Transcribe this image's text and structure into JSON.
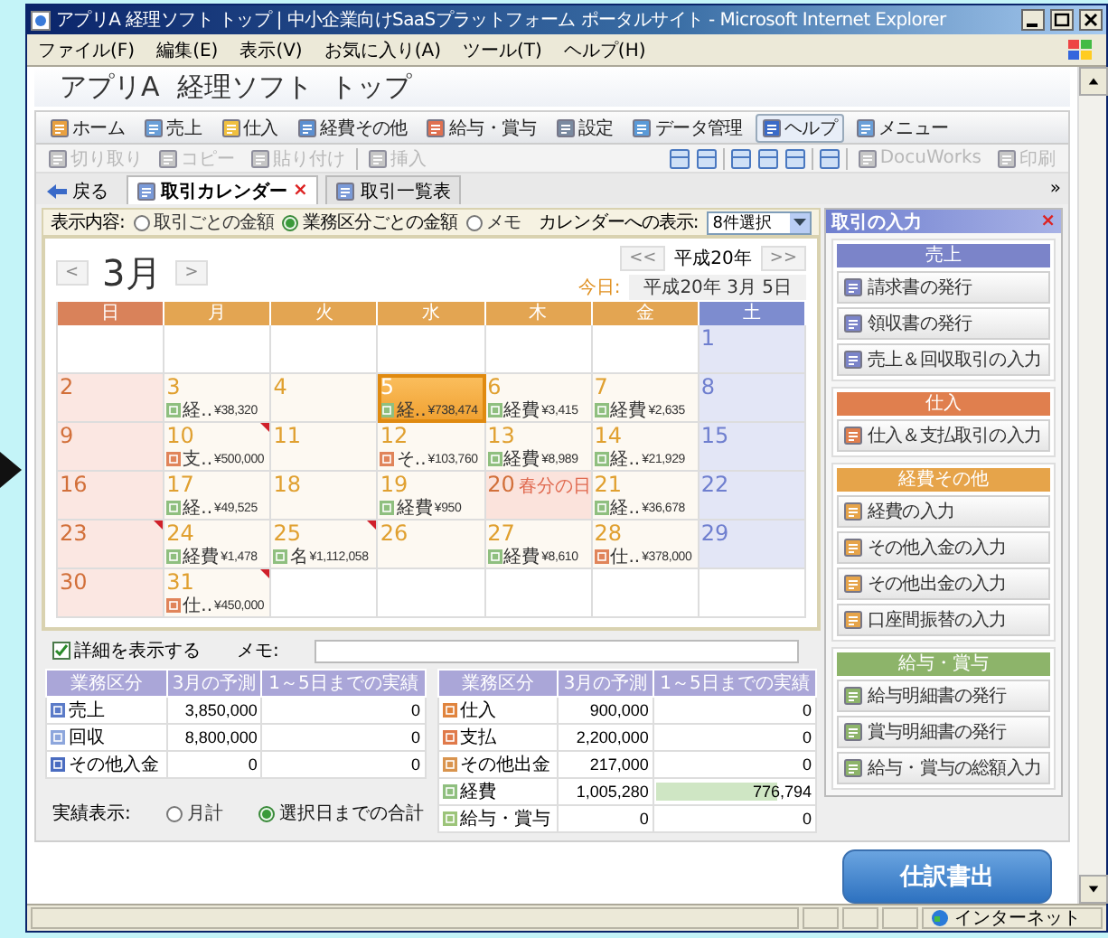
{
  "window": {
    "title": "アプリA  経理ソフト  トップ | 中小企業向けSaaSプラットフォーム ポータルサイト - Microsoft Internet Explorer"
  },
  "menu": [
    "ファイル(F)",
    "編集(E)",
    "表示(V)",
    "お気に入り(A)",
    "ツール(T)",
    "ヘルプ(H)"
  ],
  "page_title": "アプリA  経理ソフト  トップ",
  "main_toolbar": [
    {
      "label": "ホーム",
      "hovered": false
    },
    {
      "label": "売上",
      "hovered": false
    },
    {
      "label": "仕入",
      "hovered": false
    },
    {
      "label": "経費その他",
      "hovered": false
    },
    {
      "label": "給与・賞与",
      "hovered": false
    },
    {
      "label": "設定",
      "hovered": false
    },
    {
      "label": "データ管理",
      "hovered": false
    },
    {
      "label": "ヘルプ",
      "hovered": true
    },
    {
      "label": "メニュー",
      "hovered": false
    }
  ],
  "edit_toolbar": [
    {
      "kind": "button",
      "label": "切り取り",
      "disabled": true
    },
    {
      "kind": "button",
      "label": "コピー",
      "disabled": true
    },
    {
      "kind": "button",
      "label": "貼り付け",
      "disabled": true
    },
    {
      "kind": "separator"
    },
    {
      "kind": "button",
      "label": "挿入",
      "disabled": true
    },
    {
      "kind": "spacer"
    },
    {
      "kind": "icon",
      "disabled": false
    },
    {
      "kind": "icon",
      "disabled": false
    },
    {
      "kind": "separator"
    },
    {
      "kind": "icon",
      "disabled": false
    },
    {
      "kind": "icon",
      "disabled": false
    },
    {
      "kind": "icon",
      "disabled": false
    },
    {
      "kind": "separator"
    },
    {
      "kind": "icon",
      "disabled": false
    },
    {
      "kind": "separator"
    },
    {
      "kind": "button",
      "label": "DocuWorks",
      "disabled": true
    },
    {
      "kind": "button",
      "label": "印刷",
      "disabled": true
    }
  ],
  "nav": {
    "back": "戻る",
    "tabs": [
      {
        "label": "取引カレンダー",
        "selected": true,
        "close": "×"
      },
      {
        "label": "取引一覧表",
        "selected": false
      }
    ],
    "overflow": "»"
  },
  "display": {
    "label": "表示内容:",
    "options": [
      {
        "label": "取引ごとの金額",
        "selected": false
      },
      {
        "label": "業務区分ごとの金額",
        "selected": true
      },
      {
        "label": "メモ",
        "selected": false
      }
    ],
    "calendar_label": "カレンダーへの表示:",
    "calendar_select": "8件選択"
  },
  "calendar": {
    "month": "3月",
    "prev": "<",
    "next": ">",
    "year_prev": "<<",
    "year": "平成20年",
    "year_next": ">>",
    "today_label": "今日:",
    "today_value": "平成20年 3月 5日",
    "weekdays": [
      {
        "label": "日",
        "color": "#d9825a"
      },
      {
        "label": "月",
        "color": "#e3a552"
      },
      {
        "label": "火",
        "color": "#e3a552"
      },
      {
        "label": "水",
        "color": "#e3a552"
      },
      {
        "label": "木",
        "color": "#e3a552"
      },
      {
        "label": "金",
        "color": "#e3a552"
      },
      {
        "label": "土",
        "color": "#7d8ccf"
      }
    ],
    "weeks": [
      [
        {
          "kind": "blank",
          "today": false,
          "flag": false
        },
        {
          "kind": "blank",
          "today": false,
          "flag": false
        },
        {
          "kind": "blank",
          "today": false,
          "flag": false
        },
        {
          "kind": "blank",
          "today": false,
          "flag": false
        },
        {
          "kind": "blank",
          "today": false,
          "flag": false
        },
        {
          "kind": "blank",
          "today": false,
          "flag": false
        },
        {
          "kind": "sat",
          "day": "1",
          "today": false,
          "flag": false
        }
      ],
      [
        {
          "kind": "sun",
          "day": "2",
          "today": false,
          "flag": false
        },
        {
          "kind": "weekday",
          "day": "3",
          "today": false,
          "flag": false,
          "entry": {
            "tag": "経..",
            "amount": "¥38,320",
            "color": "#8fbf7f"
          }
        },
        {
          "kind": "weekday",
          "day": "4",
          "today": false,
          "flag": false
        },
        {
          "kind": "weekday",
          "day": "5",
          "today": true,
          "flag": false,
          "entry": {
            "tag": "経..",
            "amount": "¥738,474",
            "color": "#8fbf7f"
          }
        },
        {
          "kind": "weekday",
          "day": "6",
          "today": false,
          "flag": false,
          "entry": {
            "tag": "経費",
            "amount": "¥3,415",
            "color": "#8fbf7f"
          }
        },
        {
          "kind": "weekday",
          "day": "7",
          "today": false,
          "flag": false,
          "entry": {
            "tag": "経費",
            "amount": "¥2,635",
            "color": "#8fbf7f"
          }
        },
        {
          "kind": "sat",
          "day": "8",
          "today": false,
          "flag": false
        }
      ],
      [
        {
          "kind": "sun",
          "day": "9",
          "today": false,
          "flag": false
        },
        {
          "kind": "weekday",
          "day": "10",
          "today": false,
          "flag": true,
          "entry": {
            "tag": "支..",
            "amount": "¥500,000",
            "color": "#e0845a"
          }
        },
        {
          "kind": "weekday",
          "day": "11",
          "today": false,
          "flag": false
        },
        {
          "kind": "weekday",
          "day": "12",
          "today": false,
          "flag": false,
          "entry": {
            "tag": "そ..",
            "amount": "¥103,760",
            "color": "#e0845a"
          }
        },
        {
          "kind": "weekday",
          "day": "13",
          "today": false,
          "flag": false,
          "entry": {
            "tag": "経費",
            "amount": "¥8,989",
            "color": "#8fbf7f"
          }
        },
        {
          "kind": "weekday",
          "day": "14",
          "today": false,
          "flag": false,
          "entry": {
            "tag": "経..",
            "amount": "¥21,929",
            "color": "#8fbf7f"
          }
        },
        {
          "kind": "sat",
          "day": "15",
          "today": false,
          "flag": false
        }
      ],
      [
        {
          "kind": "sun",
          "day": "16",
          "today": false,
          "flag": false
        },
        {
          "kind": "weekday",
          "day": "17",
          "today": false,
          "flag": false,
          "entry": {
            "tag": "経..",
            "amount": "¥49,525",
            "color": "#8fbf7f"
          }
        },
        {
          "kind": "weekday",
          "day": "18",
          "today": false,
          "flag": false
        },
        {
          "kind": "weekday",
          "day": "19",
          "today": false,
          "flag": false,
          "entry": {
            "tag": "経費",
            "amount": "¥950",
            "color": "#8fbf7f"
          }
        },
        {
          "kind": "holiday",
          "day": "20",
          "holiday_name": "春分の日",
          "today": false,
          "flag": false
        },
        {
          "kind": "weekday",
          "day": "21",
          "today": false,
          "flag": false,
          "entry": {
            "tag": "経..",
            "amount": "¥36,678",
            "color": "#8fbf7f"
          }
        },
        {
          "kind": "sat",
          "day": "22",
          "today": false,
          "flag": false
        }
      ],
      [
        {
          "kind": "sun",
          "day": "23",
          "today": false,
          "flag": true
        },
        {
          "kind": "weekday",
          "day": "24",
          "today": false,
          "flag": false,
          "entry": {
            "tag": "経費",
            "amount": "¥1,478",
            "color": "#8fbf7f"
          }
        },
        {
          "kind": "weekday",
          "day": "25",
          "today": false,
          "flag": true,
          "entry": {
            "tag": "名",
            "amount": "¥1,112,058",
            "color": "#8fbf7f"
          }
        },
        {
          "kind": "weekday",
          "day": "26",
          "today": false,
          "flag": false
        },
        {
          "kind": "weekday",
          "day": "27",
          "today": false,
          "flag": false,
          "entry": {
            "tag": "経費",
            "amount": "¥8,610",
            "color": "#8fbf7f"
          }
        },
        {
          "kind": "weekday",
          "day": "28",
          "today": false,
          "flag": false,
          "entry": {
            "tag": "仕..",
            "amount": "¥378,000",
            "color": "#e0845a"
          }
        },
        {
          "kind": "sat",
          "day": "29",
          "today": false,
          "flag": false
        }
      ],
      [
        {
          "kind": "sun",
          "day": "30",
          "today": false,
          "flag": false
        },
        {
          "kind": "weekday",
          "day": "31",
          "today": false,
          "flag": true,
          "entry": {
            "tag": "仕..",
            "amount": "¥450,000",
            "color": "#e0845a"
          }
        },
        {
          "kind": "blank",
          "today": false,
          "flag": false
        },
        {
          "kind": "blank",
          "today": false,
          "flag": false
        },
        {
          "kind": "blank",
          "today": false,
          "flag": false
        },
        {
          "kind": "blank",
          "today": false,
          "flag": false
        },
        {
          "kind": "blank",
          "today": false,
          "flag": false
        }
      ]
    ]
  },
  "details": {
    "show_details": {
      "label": "詳細を表示する",
      "checked": true
    },
    "memo_label": "メモ:",
    "left_columns": [
      "業務区分",
      "3月の予測",
      "1～5日までの実績"
    ],
    "left_rows": [
      {
        "category": "売上",
        "color": "#5b7bc8",
        "forecast": "3,850,000",
        "actual": "0"
      },
      {
        "category": "回収",
        "color": "#8da6dc",
        "forecast": "8,800,000",
        "actual": "0"
      },
      {
        "category": "その他入金",
        "color": "#4a6cc0",
        "forecast": "0",
        "actual": "0"
      }
    ],
    "right_columns": [
      "業務区分",
      "3月の予測",
      "1～5日までの実績"
    ],
    "right_rows": [
      {
        "category": "仕入",
        "color": "#e0843e",
        "forecast": "900,000",
        "actual": "0"
      },
      {
        "category": "支払",
        "color": "#e07a4a",
        "forecast": "2,200,000",
        "actual": "0"
      },
      {
        "category": "その他出金",
        "color": "#d9944e",
        "forecast": "217,000",
        "actual": "0"
      },
      {
        "category": "経費",
        "color": "#8fbf7f",
        "forecast": "1,005,280",
        "actual": "776,794",
        "level": 0.77
      },
      {
        "category": "給与・賞与",
        "color": "#9cc47a",
        "forecast": "0",
        "actual": "0"
      }
    ],
    "actual_display": {
      "label": "実績表示:",
      "options": [
        {
          "label": "月計",
          "selected": false
        },
        {
          "label": "選択日までの合計",
          "selected": true
        }
      ]
    }
  },
  "side_panel": {
    "title": "取引の入力",
    "close": "×",
    "sections": [
      {
        "title": "売上",
        "color": "#7b84c9",
        "buttons": [
          "請求書の発行",
          "領収書の発行",
          "売上＆回収取引の入力"
        ]
      },
      {
        "title": "仕入",
        "color": "#e07f4e",
        "buttons": [
          "仕入＆支払取引の入力"
        ]
      },
      {
        "title": "経費その他",
        "color": "#e6a44a",
        "buttons": [
          "経費の入力",
          "その他入金の入力",
          "その他出金の入力",
          "口座間振替の入力"
        ]
      },
      {
        "title": "給与・賞与",
        "color": "#8db46a",
        "buttons": [
          "給与明細書の発行",
          "賞与明細書の発行",
          "給与・賞与の総額入力"
        ]
      }
    ]
  },
  "export_button": "仕訳書出",
  "status_bar": {
    "zone": "インターネット"
  }
}
